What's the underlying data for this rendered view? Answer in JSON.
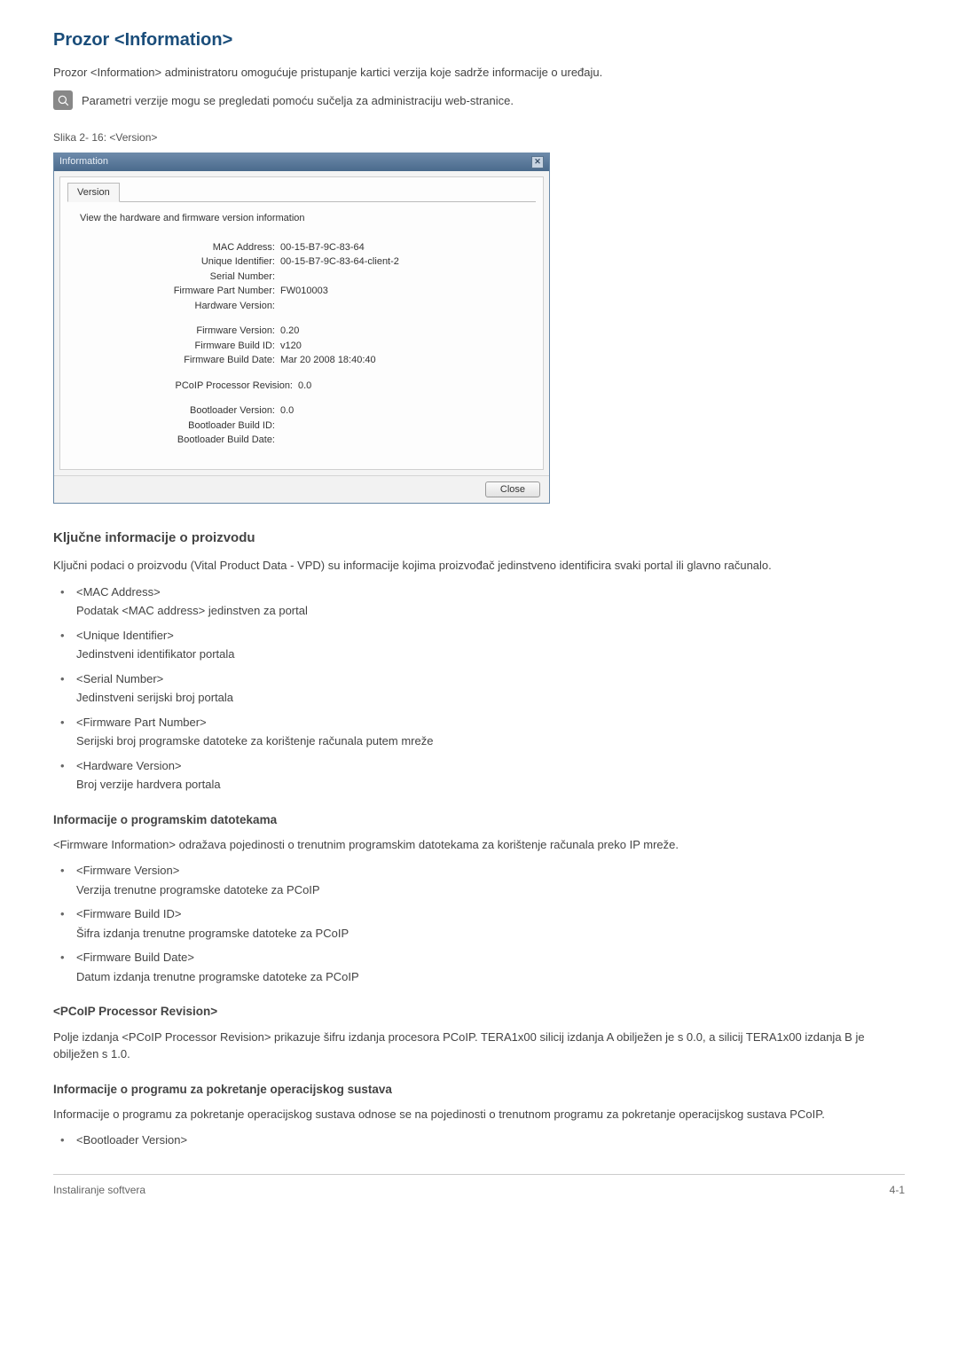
{
  "page": {
    "h1": "Prozor <Information>",
    "intro": "Prozor <Information> administratoru omogućuje pristupanje kartici verzija koje sadrže informacije o uređaju.",
    "note": "Parametri verzije mogu se pregledati pomoću sučelja za administraciju web-stranice.",
    "figure_caption": "Slika 2- 16: <Version>"
  },
  "dialog": {
    "title": "Information",
    "tab": "Version",
    "desc": "View the hardware and firmware version information",
    "vpd": [
      {
        "label": "MAC Address:",
        "value": "00-15-B7-9C-83-64"
      },
      {
        "label": "Unique Identifier:",
        "value": "00-15-B7-9C-83-64-client-2"
      },
      {
        "label": "Serial Number:",
        "value": ""
      },
      {
        "label": "Firmware Part Number:",
        "value": "FW010003"
      },
      {
        "label": "Hardware Version:",
        "value": ""
      }
    ],
    "fw": [
      {
        "label": "Firmware Version:",
        "value": "0.20"
      },
      {
        "label": "Firmware Build ID:",
        "value": "v120"
      },
      {
        "label": "Firmware Build Date:",
        "value": "Mar 20 2008 18:40:40"
      }
    ],
    "pcoip": [
      {
        "label": "PCoIP Processor Revision:",
        "value": "0.0"
      }
    ],
    "boot": [
      {
        "label": "Bootloader Version:",
        "value": "0.0"
      },
      {
        "label": "Bootloader Build ID:",
        "value": ""
      },
      {
        "label": "Bootloader Build Date:",
        "value": ""
      }
    ],
    "close_btn": "Close"
  },
  "sections": {
    "vpd_h2": "Ključne informacije o proizvodu",
    "vpd_p": "Ključni podaci o proizvodu (Vital Product Data - VPD) su informacije kojima proizvođač jedinstveno identificira svaki portal ili glavno računalo.",
    "vpd_items": [
      {
        "title": "<MAC Address>",
        "desc": "Podatak <MAC address> jedinstven za portal"
      },
      {
        "title": "<Unique Identifier>",
        "desc": "Jedinstveni identifikator portala"
      },
      {
        "title": "<Serial Number>",
        "desc": "Jedinstveni serijski broj portala"
      },
      {
        "title": "<Firmware Part Number>",
        "desc": "Serijski broj programske datoteke za korištenje računala putem mreže"
      },
      {
        "title": "<Hardware Version>",
        "desc": "Broj verzije hardvera portala"
      }
    ],
    "fw_h3": "Informacije o programskim datotekama",
    "fw_p": "<Firmware Information> odražava pojedinosti o trenutnim programskim datotekama za korištenje računala preko IP mreže.",
    "fw_items": [
      {
        "title": "<Firmware Version>",
        "desc": "Verzija trenutne programske datoteke za PCoIP"
      },
      {
        "title": "<Firmware Build ID>",
        "desc": "Šifra izdanja trenutne programske datoteke za PCoIP"
      },
      {
        "title": "<Firmware Build Date>",
        "desc": "Datum izdanja trenutne programske datoteke za PCoIP"
      }
    ],
    "pcoip_h3": "<PCoIP Processor Revision>",
    "pcoip_p": "Polje izdanja <PCoIP Processor Revision> prikazuje šifru izdanja procesora PCoIP. TERA1x00 silicij izdanja A obilježen je s 0.0, a silicij TERA1x00 izdanja B je obilježen s 1.0.",
    "boot_h3": "Informacije o programu za pokretanje operacijskog sustava",
    "boot_p": "Informacije o programu za pokretanje operacijskog sustava odnose se na pojedinosti o trenutnom programu za pokretanje operacijskog sustava PCoIP.",
    "boot_items": [
      {
        "title": "<Bootloader Version>"
      }
    ]
  },
  "footer": {
    "left": "Instaliranje softvera",
    "right": "4-1"
  }
}
